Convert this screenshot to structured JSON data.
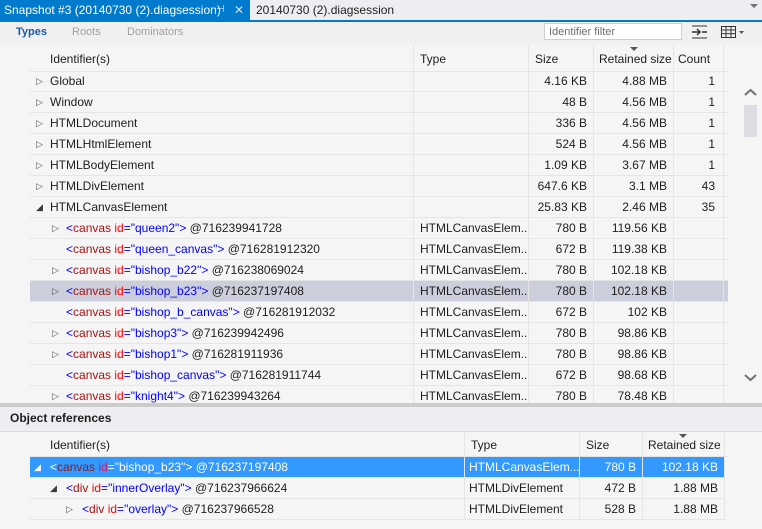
{
  "tabs": [
    {
      "label": "Snapshot #3 (20140730 (2).diagsession)",
      "active": true
    },
    {
      "label": "20140730 (2).diagsession",
      "active": false
    }
  ],
  "icons": {
    "pin": "⊣",
    "close": "✕",
    "up": "⌃",
    "down": "⌄",
    "expand": "▷",
    "collapse": "◢",
    "collapse_outline": "◿"
  },
  "view_tabs": [
    {
      "label": "Types",
      "selected": true
    },
    {
      "label": "Roots",
      "selected": false
    },
    {
      "label": "Dominators",
      "selected": false
    }
  ],
  "filter": {
    "placeholder": "Identifier filter",
    "value": ""
  },
  "colors": {
    "accent": "#007acc",
    "selection_blue": "#3399ff",
    "selection_gray": "#cccedb",
    "tag": "#a31515",
    "attr": "#ff0000",
    "value": "#0000ff"
  },
  "types_table": {
    "columns": [
      "Identifier(s)",
      "Type",
      "Size",
      "Retained size",
      "Count"
    ],
    "sorted_column": "Retained size",
    "rows": [
      {
        "level": 0,
        "expander": "closed",
        "identifier": "Global",
        "type": "",
        "size": "4.16 KB",
        "retained": "4.88 MB",
        "count": "1"
      },
      {
        "level": 0,
        "expander": "closed",
        "identifier": "Window",
        "type": "",
        "size": "48 B",
        "retained": "4.56 MB",
        "count": "1"
      },
      {
        "level": 0,
        "expander": "closed",
        "identifier": "HTMLDocument",
        "type": "",
        "size": "336 B",
        "retained": "4.56 MB",
        "count": "1"
      },
      {
        "level": 0,
        "expander": "closed",
        "identifier": "HTMLHtmlElement",
        "type": "",
        "size": "524 B",
        "retained": "4.56 MB",
        "count": "1"
      },
      {
        "level": 0,
        "expander": "closed",
        "identifier": "HTMLBodyElement",
        "type": "",
        "size": "1.09 KB",
        "retained": "3.67 MB",
        "count": "1"
      },
      {
        "level": 0,
        "expander": "closed",
        "identifier": "HTMLDivElement",
        "type": "",
        "size": "647.6 KB",
        "retained": "3.1 MB",
        "count": "43"
      },
      {
        "level": 0,
        "expander": "open",
        "identifier": "HTMLCanvasElement",
        "type": "",
        "size": "25.83 KB",
        "retained": "2.46 MB",
        "count": "35"
      },
      {
        "level": 1,
        "expander": "closed",
        "tag": "canvas",
        "id": "queen2",
        "address": "@716239941728",
        "type": "HTMLCanvasElem...",
        "size": "780 B",
        "retained": "119.56 KB",
        "count": ""
      },
      {
        "level": 1,
        "expander": "none",
        "tag": "canvas",
        "id": "queen_canvas",
        "address": "@716281912320",
        "type": "HTMLCanvasElem...",
        "size": "672 B",
        "retained": "119.38 KB",
        "count": ""
      },
      {
        "level": 1,
        "expander": "closed",
        "tag": "canvas",
        "id": "bishop_b22",
        "address": "@716238069024",
        "type": "HTMLCanvasElem...",
        "size": "780 B",
        "retained": "102.18 KB",
        "count": ""
      },
      {
        "level": 1,
        "expander": "closed",
        "tag": "canvas",
        "id": "bishop_b23",
        "address": "@716237197408",
        "type": "HTMLCanvasElem...",
        "size": "780 B",
        "retained": "102.18 KB",
        "count": "",
        "selected": true
      },
      {
        "level": 1,
        "expander": "none",
        "tag": "canvas",
        "id": "bishop_b_canvas",
        "address": "@716281912032",
        "type": "HTMLCanvasElem...",
        "size": "672 B",
        "retained": "102 KB",
        "count": ""
      },
      {
        "level": 1,
        "expander": "closed",
        "tag": "canvas",
        "id": "bishop3",
        "address": "@716239942496",
        "type": "HTMLCanvasElem...",
        "size": "780 B",
        "retained": "98.86 KB",
        "count": ""
      },
      {
        "level": 1,
        "expander": "closed",
        "tag": "canvas",
        "id": "bishop1",
        "address": "@716281911936",
        "type": "HTMLCanvasElem...",
        "size": "780 B",
        "retained": "98.86 KB",
        "count": ""
      },
      {
        "level": 1,
        "expander": "none",
        "tag": "canvas",
        "id": "bishop_canvas",
        "address": "@716281911744",
        "type": "HTMLCanvasElem...",
        "size": "672 B",
        "retained": "98.68 KB",
        "count": ""
      },
      {
        "level": 1,
        "expander": "closed",
        "tag": "canvas",
        "id": "knight4",
        "address": "@716239943264",
        "type": "HTMLCanvasElem...",
        "size": "780 B",
        "retained": "78.48 KB",
        "count": ""
      }
    ]
  },
  "references": {
    "title": "Object references",
    "columns": [
      "Identifier(s)",
      "Type",
      "Size",
      "Retained size"
    ],
    "sorted_column": "Retained size",
    "rows": [
      {
        "level": 0,
        "expander": "open",
        "tag": "canvas",
        "id": "bishop_b23",
        "address": "@716237197408",
        "type": "HTMLCanvasElem...",
        "size": "780 B",
        "retained": "102.18 KB",
        "selected": true
      },
      {
        "level": 1,
        "expander": "open",
        "tag": "div",
        "id": "innerOverlay",
        "address": "@716237966624",
        "type": "HTMLDivElement",
        "size": "472 B",
        "retained": "1.88 MB"
      },
      {
        "level": 2,
        "expander": "closed",
        "tag": "div",
        "id": "overlay",
        "address": "@716237966528",
        "type": "HTMLDivElement",
        "size": "528 B",
        "retained": "1.88 MB"
      }
    ]
  }
}
